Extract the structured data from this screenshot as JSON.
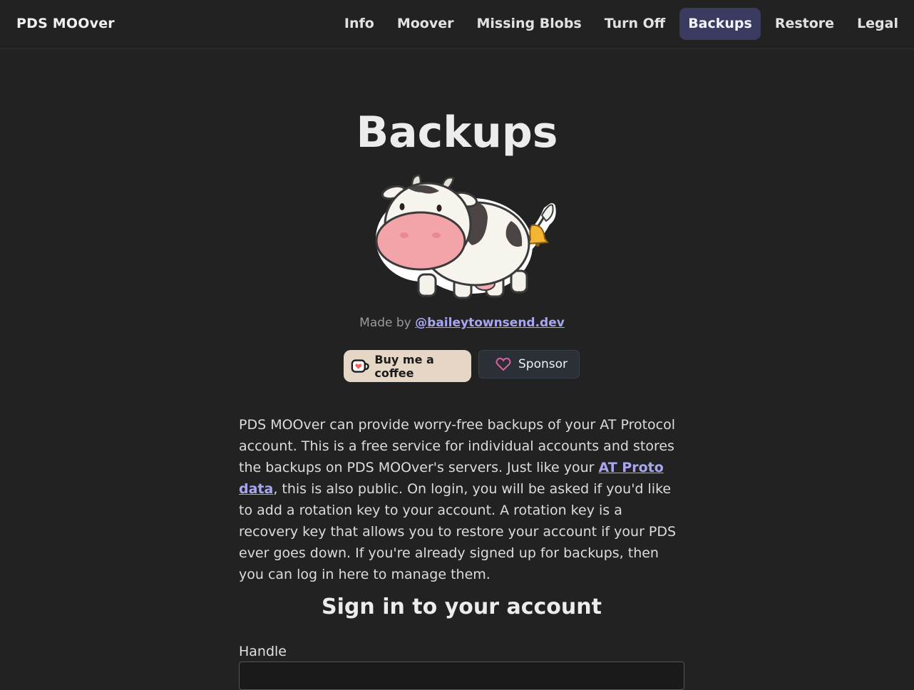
{
  "brand": "PDS MOOver",
  "nav": {
    "items": [
      {
        "label": "Info"
      },
      {
        "label": "Moover"
      },
      {
        "label": "Missing Blobs"
      },
      {
        "label": "Turn Off"
      },
      {
        "label": "Backups",
        "active": true
      },
      {
        "label": "Restore"
      },
      {
        "label": "Legal"
      }
    ]
  },
  "page": {
    "title": "Backups",
    "made_by_prefix": "Made by",
    "made_by_handle": "@baileytownsend.dev"
  },
  "buttons": {
    "coffee_label": "Buy me a coffee",
    "sponsor_label": "Sponsor"
  },
  "intro": {
    "part1": "PDS MOOver can provide worry-free backups of your AT Protocol account. This is a free service for individual accounts and stores the backups on PDS MOOver's servers. Just like your ",
    "link": "AT Proto data",
    "part2": ", this is also public. On login, you will be asked if you'd like to add a rotation key to your account. A rotation key is a recovery key that allows you to restore your account if your PDS ever goes down. If you're already signed up for backups, then you can log in here to manage them."
  },
  "signin": {
    "title": "Sign in to your account",
    "handle_label": "Handle",
    "handle_value": ""
  },
  "colors": {
    "background": "#222222",
    "accent": "#a8a6f2",
    "active_nav": "#3b3a60",
    "coffee_button": "#e6d6c6",
    "sponsor_heart": "#db61a2"
  },
  "icons": {
    "mascot": "cow-mascot",
    "coffee": "coffee-cup-icon",
    "sponsor": "heart-icon"
  }
}
